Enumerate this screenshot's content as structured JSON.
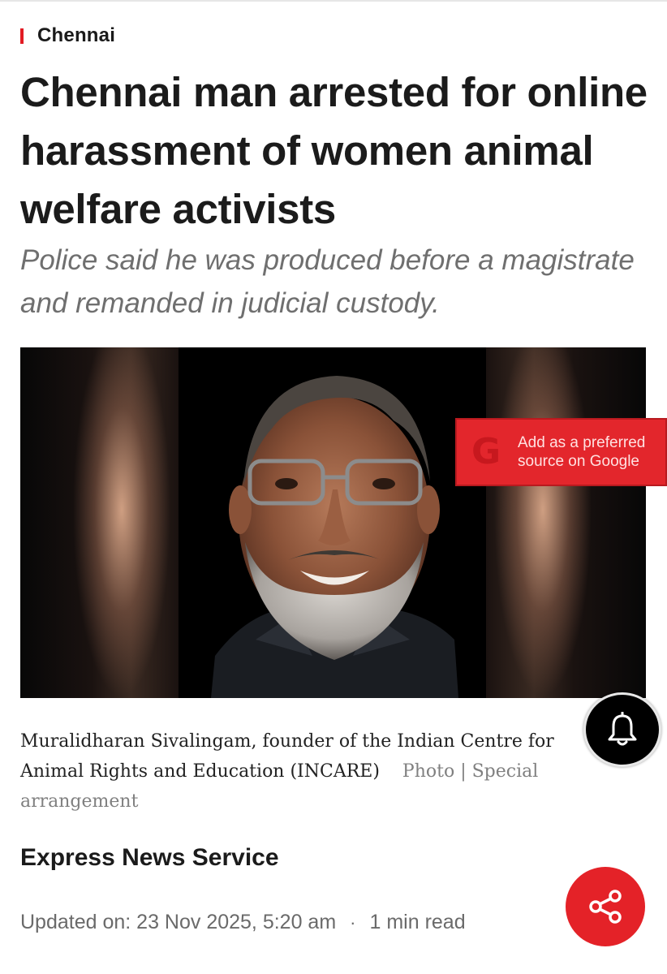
{
  "section": {
    "label": "Chennai"
  },
  "article": {
    "headline": "Chennai man arrested for online harassment of women animal welfare activists",
    "subheadline": "Police said he was produced before a magistrate and remanded in judicial custody.",
    "photo": {
      "caption": "Muralidharan Sivalingam, founder of the Indian Centre for Animal Rights and Education (INCARE)",
      "credit": "Photo | Special arrangement"
    },
    "author": "Express News Service",
    "updated": "Updated on: 23 Nov 2025, 5:20 am",
    "separator": "·",
    "read_time": "1 min read"
  },
  "google_badge": {
    "logo": "G",
    "line1": "Add as a preferred",
    "line2": "source on Google"
  },
  "icons": {
    "notification": "bell-icon",
    "share": "share-icon"
  },
  "colors": {
    "accent": "#e21b23",
    "text": "#1b1b1b",
    "subtext": "#6f6f6f",
    "bell_bg": "#000000"
  }
}
